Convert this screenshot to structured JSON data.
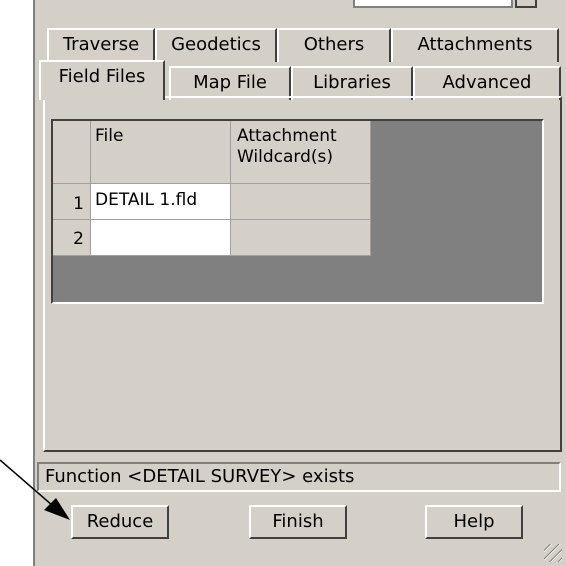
{
  "tabs_row1": [
    {
      "label": "Traverse"
    },
    {
      "label": "Geodetics"
    },
    {
      "label": "Others"
    },
    {
      "label": "Attachments"
    }
  ],
  "tabs_row2": [
    {
      "label": "Field Files",
      "active": true
    },
    {
      "label": "Map File"
    },
    {
      "label": "Libraries"
    },
    {
      "label": "Advanced"
    }
  ],
  "table": {
    "columns": [
      {
        "line1": "File",
        "line2": ""
      },
      {
        "line1": "Attachment",
        "line2": "Wildcard(s)"
      }
    ],
    "rows": [
      {
        "num": "1",
        "file": "DETAIL 1.fld",
        "wildcard": ""
      },
      {
        "num": "2",
        "file": "",
        "wildcard": ""
      }
    ]
  },
  "status": {
    "text": "Function <DETAIL SURVEY> exists"
  },
  "buttons": {
    "reduce": "Reduce",
    "finish": "Finish",
    "help": "Help"
  },
  "colors": {
    "dialog_bg": "#d4d0c8",
    "grid_bg": "#808080"
  }
}
